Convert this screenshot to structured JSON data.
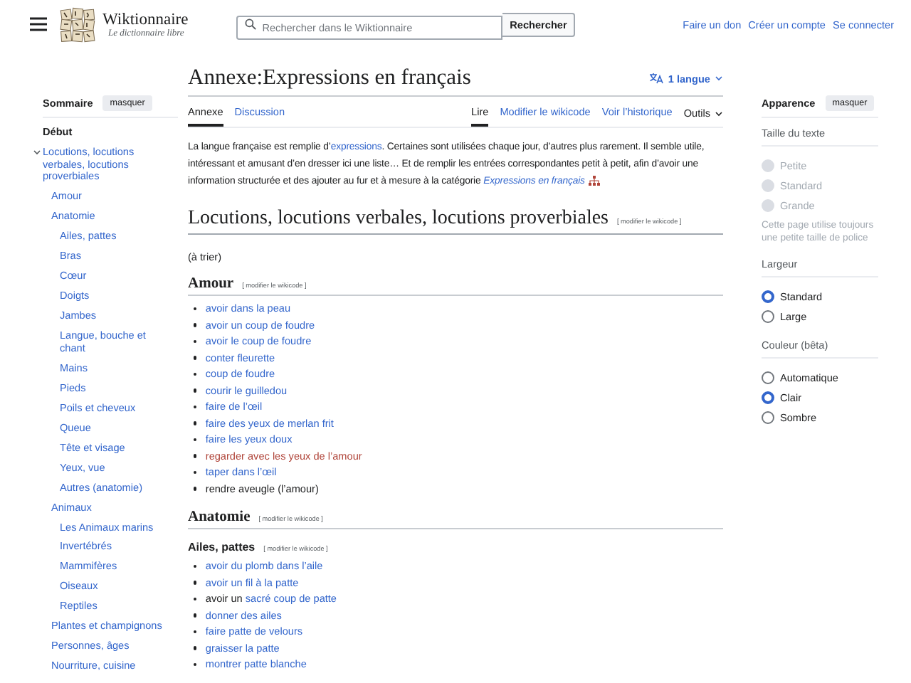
{
  "header": {
    "site_name": "Wiktionnaire",
    "tagline": "Le dictionnaire libre",
    "search": {
      "placeholder": "Rechercher dans le Wiktionnaire",
      "button": "Rechercher"
    },
    "user_links": [
      "Faire un don",
      "Créer un compte",
      "Se connecter"
    ]
  },
  "toc": {
    "title": "Sommaire",
    "hide_button": "masquer",
    "items": [
      {
        "label": "Début",
        "selected": true
      },
      {
        "label": "Locutions, locutions verbales, locutions proverbiales",
        "selected": false,
        "expanded": true,
        "children": [
          {
            "label": "Amour",
            "selected": false
          },
          {
            "label": "Anatomie",
            "selected": false,
            "children": [
              {
                "label": "Ailes, pattes",
                "selected": false
              },
              {
                "label": "Bras",
                "selected": false
              },
              {
                "label": "Cœur",
                "selected": false
              },
              {
                "label": "Doigts",
                "selected": false
              },
              {
                "label": "Jambes",
                "selected": false
              },
              {
                "label": "Langue, bouche et chant",
                "selected": false
              },
              {
                "label": "Mains",
                "selected": false
              },
              {
                "label": "Pieds",
                "selected": false
              },
              {
                "label": "Poils et cheveux",
                "selected": false
              },
              {
                "label": "Queue",
                "selected": false
              },
              {
                "label": "Tête et visage",
                "selected": false
              },
              {
                "label": "Yeux, vue",
                "selected": false
              },
              {
                "label": "Autres (anatomie)",
                "selected": false
              }
            ]
          },
          {
            "label": "Animaux",
            "selected": false,
            "children": [
              {
                "label": "Les Animaux marins",
                "selected": false
              },
              {
                "label": "Invertébrés",
                "selected": false
              },
              {
                "label": "Mammifères",
                "selected": false
              },
              {
                "label": "Oiseaux",
                "selected": false
              },
              {
                "label": "Reptiles",
                "selected": false
              }
            ]
          },
          {
            "label": "Plantes et champignons",
            "selected": false
          },
          {
            "label": "Personnes, âges",
            "selected": false
          },
          {
            "label": "Nourriture, cuisine",
            "selected": false
          }
        ]
      }
    ]
  },
  "page": {
    "title": "Annexe:Expressions en français",
    "language_button": "1 langue",
    "left_tabs": [
      {
        "label": "Annexe",
        "selected": true
      },
      {
        "label": "Discussion",
        "selected": false
      }
    ],
    "right_tabs": [
      {
        "label": "Lire",
        "selected": true
      },
      {
        "label": "Modifier le wikicode",
        "selected": false
      },
      {
        "label": "Voir l’historique",
        "selected": false
      }
    ],
    "tools_menu": "Outils",
    "intro": [
      {
        "text": "La langue française est remplie d’",
        "kind": "plain"
      },
      {
        "text": "expressions",
        "kind": "link"
      },
      {
        "text": ". Certaines sont utilisées chaque jour, d’autres plus rarement. Il semble utile, intéressant et amusant d’en dresser ici une liste… Et de remplir les entrées correspondantes petit à petit, afin d’avoir une information structurée et des ajouter au fur et à mesure à la catégorie ",
        "kind": "plain"
      },
      {
        "text": "Expressions en français",
        "kind": "italic_link"
      }
    ],
    "sections": [
      {
        "kind": "h2",
        "title": "Locutions, locutions verbales, locutions proverbiales",
        "edit": "[ modifier le wikicode ]",
        "note": "(à trier)"
      },
      {
        "kind": "h3",
        "title": "Amour",
        "edit": "[ modifier le wikicode ]",
        "items": [
          [
            {
              "text": "avoir dans la peau",
              "kind": "link"
            }
          ],
          [
            {
              "text": "avoir un coup de foudre",
              "kind": "link"
            }
          ],
          [
            {
              "text": "avoir le coup de foudre",
              "kind": "link"
            }
          ],
          [
            {
              "text": "conter fleurette",
              "kind": "link"
            }
          ],
          [
            {
              "text": "coup de foudre",
              "kind": "link"
            }
          ],
          [
            {
              "text": "courir le guilledou",
              "kind": "link"
            }
          ],
          [
            {
              "text": "faire de l’œil",
              "kind": "link"
            }
          ],
          [
            {
              "text": "faire des yeux de merlan frit",
              "kind": "link"
            }
          ],
          [
            {
              "text": "faire les yeux doux",
              "kind": "link"
            }
          ],
          [
            {
              "text": "regarder avec les yeux de l’amour",
              "kind": "redlink"
            }
          ],
          [
            {
              "text": "taper dans l’œil",
              "kind": "link"
            }
          ],
          [
            {
              "text": "rendre aveugle (l’amour)",
              "kind": "plain"
            }
          ]
        ]
      },
      {
        "kind": "h3",
        "title": "Anatomie",
        "edit": "[ modifier le wikicode ]"
      },
      {
        "kind": "h4",
        "title": "Ailes, pattes",
        "edit": "[ modifier le wikicode ]",
        "items": [
          [
            {
              "text": "avoir du plomb dans l’aile",
              "kind": "link"
            }
          ],
          [
            {
              "text": "avoir un fil à la patte",
              "kind": "link"
            }
          ],
          [
            {
              "text": "avoir un ",
              "kind": "plain"
            },
            {
              "text": "sacré coup de patte",
              "kind": "link"
            }
          ],
          [
            {
              "text": "donner des ailes",
              "kind": "link"
            }
          ],
          [
            {
              "text": "faire patte de velours",
              "kind": "link"
            }
          ],
          [
            {
              "text": "graisser la patte",
              "kind": "link"
            }
          ],
          [
            {
              "text": "montrer patte blanche",
              "kind": "link"
            }
          ]
        ]
      }
    ]
  },
  "appearance": {
    "title": "Apparence",
    "hide_button": "masquer",
    "groups": [
      {
        "label": "Taille du texte",
        "options": [
          {
            "label": "Petite",
            "selected": false,
            "disabled": true
          },
          {
            "label": "Standard",
            "selected": false,
            "disabled": true
          },
          {
            "label": "Grande",
            "selected": false,
            "disabled": true
          }
        ],
        "note": "Cette page utilise toujours une petite taille de police"
      },
      {
        "label": "Largeur",
        "options": [
          {
            "label": "Standard",
            "selected": true,
            "disabled": false
          },
          {
            "label": "Large",
            "selected": false,
            "disabled": false
          }
        ]
      },
      {
        "label": "Couleur (bêta)",
        "options": [
          {
            "label": "Automatique",
            "selected": false,
            "disabled": false
          },
          {
            "label": "Clair",
            "selected": true,
            "disabled": false
          },
          {
            "label": "Sombre",
            "selected": false,
            "disabled": false
          }
        ]
      }
    ]
  }
}
